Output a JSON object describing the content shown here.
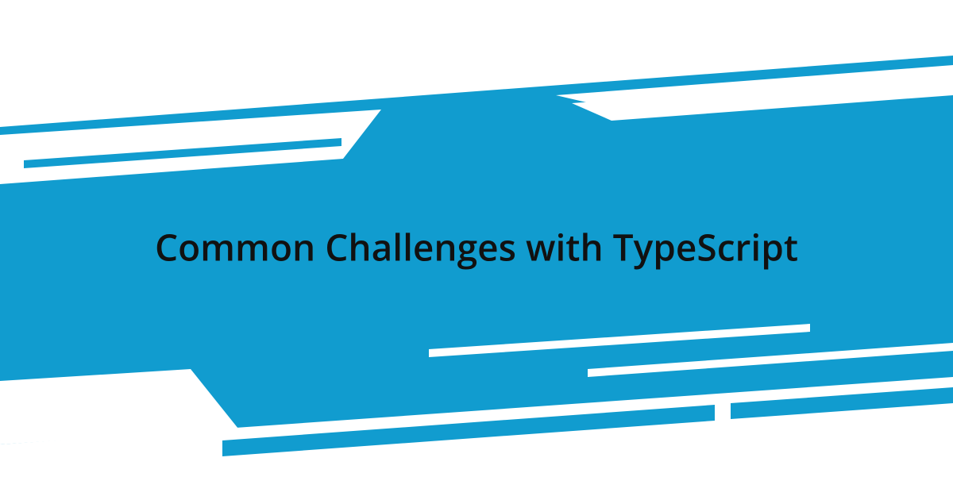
{
  "title": "Common Challenges with TypeScript",
  "colors": {
    "accent": "#119ccf",
    "background": "#ffffff",
    "text": "#111111"
  }
}
